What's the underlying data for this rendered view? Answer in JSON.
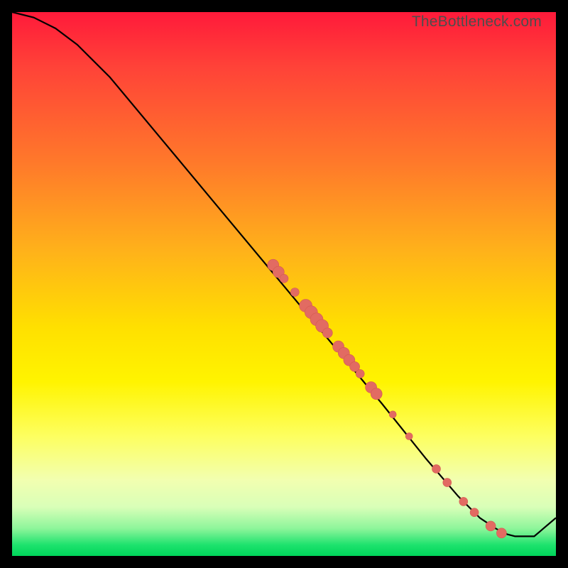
{
  "watermark": "TheBottleneck.com",
  "chart_data": {
    "type": "line",
    "title": "",
    "xlabel": "",
    "ylabel": "",
    "xlim": [
      0,
      100
    ],
    "ylim": [
      0,
      100
    ],
    "grid": false,
    "series": [
      {
        "name": "curve",
        "x": [
          0,
          4,
          8,
          12,
          18,
          28,
          38,
          48,
          58,
          68,
          76,
          82,
          86,
          89,
          91,
          92.5,
          94,
          96,
          100
        ],
        "y": [
          100,
          99,
          97,
          94,
          88,
          76,
          64,
          52,
          40,
          28,
          18,
          11,
          7,
          5,
          4,
          3.6,
          3.6,
          3.6,
          7
        ]
      }
    ],
    "points": [
      {
        "x": 48,
        "y": 53.5,
        "r": 8
      },
      {
        "x": 49,
        "y": 52.2,
        "r": 8
      },
      {
        "x": 50,
        "y": 51,
        "r": 6
      },
      {
        "x": 52,
        "y": 48.5,
        "r": 6
      },
      {
        "x": 54,
        "y": 46,
        "r": 9
      },
      {
        "x": 55,
        "y": 44.8,
        "r": 9
      },
      {
        "x": 56,
        "y": 43.5,
        "r": 9
      },
      {
        "x": 57,
        "y": 42.3,
        "r": 9
      },
      {
        "x": 58,
        "y": 41,
        "r": 7
      },
      {
        "x": 60,
        "y": 38.5,
        "r": 8
      },
      {
        "x": 61,
        "y": 37.3,
        "r": 8
      },
      {
        "x": 62,
        "y": 36,
        "r": 8
      },
      {
        "x": 63,
        "y": 34.8,
        "r": 7
      },
      {
        "x": 64,
        "y": 33.5,
        "r": 6
      },
      {
        "x": 66,
        "y": 31,
        "r": 8
      },
      {
        "x": 67,
        "y": 29.8,
        "r": 8
      },
      {
        "x": 70,
        "y": 26,
        "r": 5
      },
      {
        "x": 73,
        "y": 22,
        "r": 5
      },
      {
        "x": 78,
        "y": 16,
        "r": 6
      },
      {
        "x": 80,
        "y": 13.5,
        "r": 6
      },
      {
        "x": 83,
        "y": 10,
        "r": 6
      },
      {
        "x": 85,
        "y": 8,
        "r": 6
      },
      {
        "x": 88,
        "y": 5.5,
        "r": 7
      },
      {
        "x": 90,
        "y": 4.2,
        "r": 7
      }
    ],
    "colors": {
      "line": "#000000",
      "points": "#e26b62",
      "gradient_top": "#ff1a3a",
      "gradient_mid": "#ffe000",
      "gradient_bottom": "#00d65a"
    }
  }
}
